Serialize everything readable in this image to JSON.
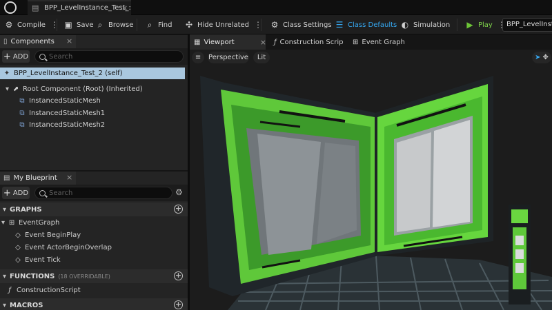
{
  "document_tab": {
    "title": "BPP_LevelInstance_Test_:",
    "close": "×"
  },
  "toolbar": {
    "compile": "Compile",
    "save": "Save",
    "browse": "Browse",
    "find": "Find",
    "hide_unrelated": "Hide Unrelated",
    "class_settings": "Class Settings",
    "class_defaults": "Class Defaults",
    "simulation": "Simulation",
    "play": "Play",
    "level_select": "BPP_LevelInstan",
    "accent_color": "#35a7f0",
    "play_color": "#7fd34b"
  },
  "components": {
    "tab_label": "Components",
    "add_label": "ADD",
    "search_placeholder": "Search",
    "self_item": "BPP_LevelInstance_Test_2 (self)",
    "root_item": "Root Component (Root) (Inherited)",
    "children": [
      "InstancedStaticMesh",
      "InstancedStaticMesh1",
      "InstancedStaticMesh2"
    ]
  },
  "my_blueprint": {
    "tab_label": "My Blueprint",
    "add_label": "ADD",
    "search_placeholder": "Search",
    "graphs_header": "GRAPHS",
    "event_graph": "EventGraph",
    "events": [
      "Event BeginPlay",
      "Event ActorBeginOverlap",
      "Event Tick"
    ],
    "functions_header": "FUNCTIONS",
    "functions_sub": "(18 OVERRIDABLE)",
    "construction_script": "ConstructionScript",
    "macros_header": "MACROS"
  },
  "editor_tabs": [
    "Viewport",
    "Construction Scrip",
    "Event Graph"
  ],
  "viewport": {
    "perspective": "Perspective",
    "lit": "Lit",
    "accent_green": "#5ed63a"
  }
}
